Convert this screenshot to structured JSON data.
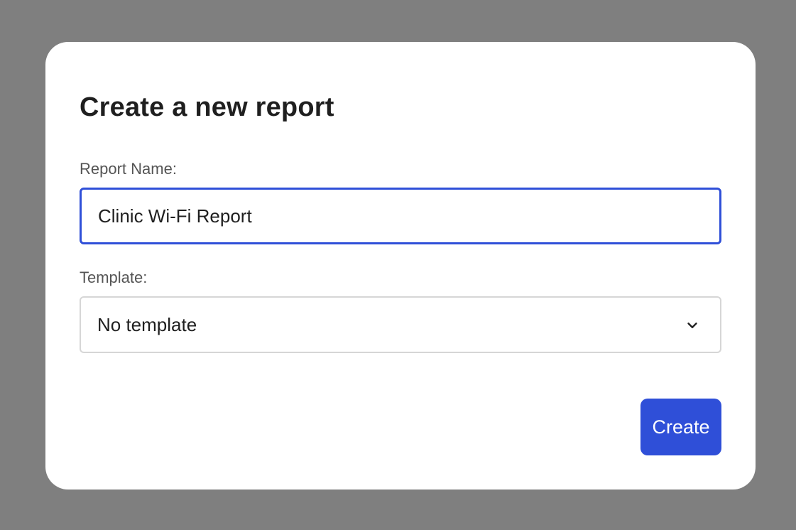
{
  "dialog": {
    "title": "Create a new report",
    "report_name": {
      "label": "Report Name:",
      "value": "Clinic Wi-Fi Report"
    },
    "template": {
      "label": "Template:",
      "selected": "No template",
      "icon": "chevron-down-icon"
    },
    "create_label": "Create"
  },
  "colors": {
    "backdrop": "#7f7f7f",
    "accent": "#2f4fd8",
    "surface": "#ffffff",
    "text": "#1f1f1f",
    "label_text": "#555555"
  }
}
